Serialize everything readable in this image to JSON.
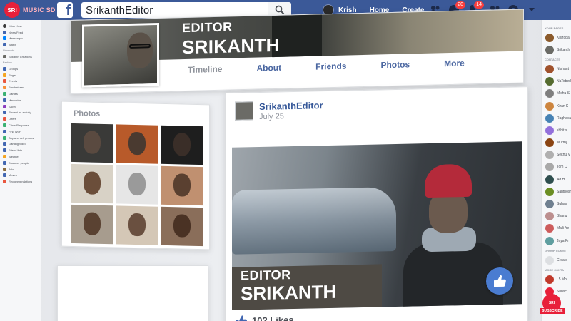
{
  "watermark": {
    "badge": "SRI",
    "brand": "MUSIC SD",
    "subscribe": "SUBSCRIBE"
  },
  "topbar": {
    "search_value": "SrikanthEditor",
    "user_name": "Krish",
    "home": "Home",
    "create": "Create",
    "messages_count": "20",
    "notifications_count": "14"
  },
  "leftbar": {
    "profile_name": "Krish Krish",
    "sections": [
      {
        "items": [
          {
            "label": "News Feed",
            "color": "#4267b2"
          },
          {
            "label": "Messenger",
            "color": "#0084ff"
          },
          {
            "label": "Watch",
            "color": "#4267b2"
          }
        ]
      },
      {
        "heading": "Shortcuts",
        "items": [
          {
            "label": "Srikanth Creations",
            "color": "#6b6b66"
          }
        ]
      },
      {
        "heading": "Explore",
        "items": [
          {
            "label": "Groups",
            "color": "#4267b2"
          },
          {
            "label": "Pages",
            "color": "#f5a623"
          },
          {
            "label": "Events",
            "color": "#e9573f"
          },
          {
            "label": "Fundraisers",
            "color": "#f7923a"
          },
          {
            "label": "Games",
            "color": "#3bb273"
          },
          {
            "label": "Memories",
            "color": "#4267b2"
          },
          {
            "label": "Saved",
            "color": "#8c3fbf"
          },
          {
            "label": "Recent ad activity",
            "color": "#4267b2"
          },
          {
            "label": "Offers",
            "color": "#e9573f"
          },
          {
            "label": "Crisis Response",
            "color": "#3bb273"
          },
          {
            "label": "Find Wi-Fi",
            "color": "#4267b2"
          },
          {
            "label": "Buy and sell groups",
            "color": "#3bb273"
          },
          {
            "label": "Gaming video",
            "color": "#4267b2"
          },
          {
            "label": "Friend lists",
            "color": "#4267b2"
          },
          {
            "label": "Weather",
            "color": "#f5a623"
          },
          {
            "label": "Discover people",
            "color": "#4267b2"
          },
          {
            "label": "Jobs",
            "color": "#8c6d3f"
          },
          {
            "label": "Moves",
            "color": "#4267b2"
          },
          {
            "label": "Recommendations",
            "color": "#e9573f"
          }
        ]
      }
    ]
  },
  "rightbar": {
    "pages_heading": "YOUR PAGES",
    "pages": [
      {
        "name": "Kiszoba",
        "color": "#8b5a2b"
      },
      {
        "name": "Srikanth",
        "color": "#6b6b66"
      }
    ],
    "contacts_heading": "CONTACTS",
    "contacts": [
      {
        "name": "Nishant",
        "color": "#a0522d"
      },
      {
        "name": "NaToberk",
        "color": "#556b2f"
      },
      {
        "name": "Mishu S",
        "color": "#7f7f7f"
      },
      {
        "name": "Kiran K",
        "color": "#cd853f"
      },
      {
        "name": "Raghava",
        "color": "#4682b4"
      },
      {
        "name": "shhit s",
        "color": "#9370db"
      },
      {
        "name": "Murthy",
        "color": "#8b4513"
      },
      {
        "name": "Sekhu V",
        "color": "#b0b0b0"
      },
      {
        "name": "Tom C",
        "color": "#a9a9a9"
      },
      {
        "name": "Ad H",
        "color": "#2f4f4f"
      },
      {
        "name": "Santhosh",
        "color": "#6b8e23"
      },
      {
        "name": "Suhas",
        "color": "#708090"
      },
      {
        "name": "Bhanu",
        "color": "#bc8f8f"
      },
      {
        "name": "Malli Ye",
        "color": "#cd5c5c"
      },
      {
        "name": "Jaya Pr",
        "color": "#5f9ea0"
      }
    ],
    "group_heading": "GROUP CONVE",
    "group_item": "Create",
    "more_heading": "MORE CONTA",
    "more_items": [
      {
        "name": "I 5 Mo",
        "color": "#c0392b"
      },
      {
        "name": "Subsc",
        "color": "#e8203a"
      }
    ]
  },
  "cover": {
    "title_small": "EDITOR",
    "title_large": "SRIKANTH",
    "tabs": [
      "Timeline",
      "About",
      "Friends",
      "Photos",
      "More"
    ]
  },
  "photos": {
    "title": "Photos",
    "tiles": [
      {
        "bg": "#3a3a38",
        "head": "#5a4a40"
      },
      {
        "bg": "#b85a2a",
        "head": "#4a3a30"
      },
      {
        "bg": "#1e1e1e",
        "head": "#3a2e28"
      },
      {
        "bg": "#d8d2c6",
        "head": "#6b4e3a"
      },
      {
        "bg": "#e6e6e6",
        "head": "#9a9a9a"
      },
      {
        "bg": "#c09070",
        "head": "#5a4030"
      },
      {
        "bg": "#a79c8e",
        "head": "#5a4232"
      },
      {
        "bg": "#d4c7b6",
        "head": "#6a5040"
      },
      {
        "bg": "#8a6e5a",
        "head": "#4a3224"
      }
    ]
  },
  "post": {
    "author": "SrikanthEditor",
    "date": "July 25",
    "overlay_small": "EDITOR",
    "overlay_large": "SRIKANTH",
    "likes": "102 Likes"
  }
}
